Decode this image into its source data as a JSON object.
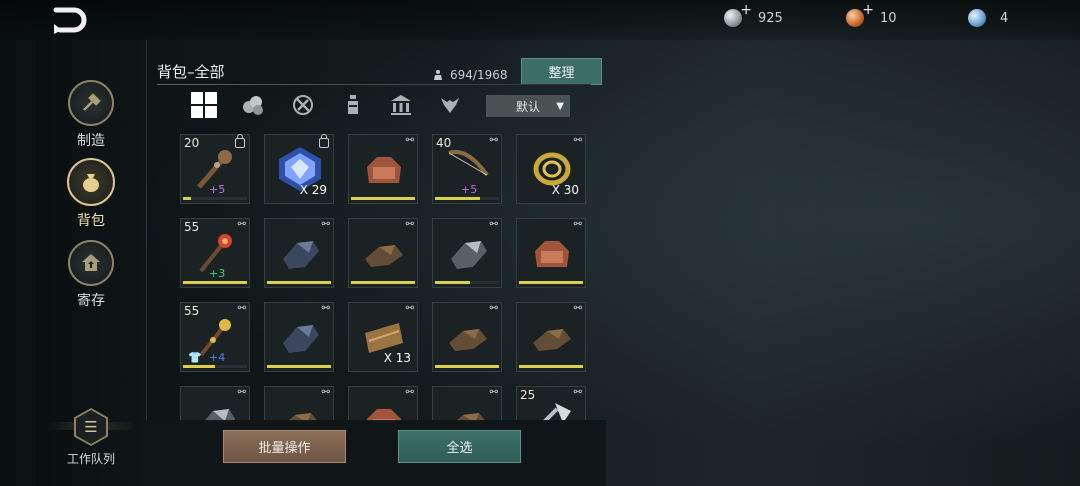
{
  "header": {
    "currencies": [
      {
        "icon": "silver-coin-icon",
        "value": "925"
      },
      {
        "icon": "bronze-coin-icon",
        "value": "10"
      },
      {
        "icon": "blue-orb-icon",
        "value": "4"
      }
    ]
  },
  "sidebar": {
    "items": [
      {
        "label": "制造",
        "icon": "hammer-icon",
        "active": false
      },
      {
        "label": "背包",
        "icon": "bag-icon",
        "active": true
      },
      {
        "label": "寄存",
        "icon": "storage-icon",
        "active": false
      }
    ],
    "work_queue": {
      "label": "工作队列",
      "icon": "queue-icon"
    }
  },
  "panel": {
    "title": "背包–全部",
    "capacity": "694/1968",
    "sort_label": "整理",
    "filter_dropdown": "默认",
    "filter_tabs": [
      "all-icon",
      "resources-icon",
      "tools-icon",
      "potion-icon",
      "building-icon",
      "creature-icon"
    ]
  },
  "inventory": [
    {
      "level": "20",
      "lock": true,
      "plus": "+5",
      "plus_color": "#c36ee8",
      "qty": "",
      "durability": 0.12,
      "item": "spiked-club"
    },
    {
      "level": "",
      "lock": true,
      "plus": "",
      "plus_color": "",
      "qty": "X 29",
      "durability": null,
      "item": "blue-crystal"
    },
    {
      "level": "",
      "lock": false,
      "plus": "",
      "plus_color": "",
      "qty": "",
      "durability": 1.0,
      "item": "leather-armor"
    },
    {
      "level": "40",
      "lock": false,
      "plus": "+5",
      "plus_color": "#c36ee8",
      "qty": "",
      "durability": 0.7,
      "item": "bow"
    },
    {
      "level": "",
      "lock": false,
      "plus": "",
      "plus_color": "",
      "qty": "X 30",
      "durability": null,
      "item": "rope"
    },
    {
      "level": "55",
      "lock": false,
      "plus": "+3",
      "plus_color": "#3fd36a",
      "qty": "",
      "durability": 1.0,
      "item": "fire-staff"
    },
    {
      "level": "",
      "lock": false,
      "plus": "",
      "plus_color": "",
      "qty": "",
      "durability": 1.0,
      "item": "blue-gauntlet"
    },
    {
      "level": "",
      "lock": false,
      "plus": "",
      "plus_color": "",
      "qty": "",
      "durability": 1.0,
      "item": "leather-gauntlet"
    },
    {
      "level": "",
      "lock": false,
      "plus": "",
      "plus_color": "",
      "qty": "",
      "durability": 0.55,
      "item": "steel-gauntlet"
    },
    {
      "level": "",
      "lock": false,
      "plus": "",
      "plus_color": "",
      "qty": "",
      "durability": 1.0,
      "item": "leather-armor"
    },
    {
      "level": "55",
      "lock": false,
      "plus": "+4",
      "plus_color": "#4f7df0",
      "qty": "",
      "durability": 0.5,
      "item": "gold-staff",
      "shirt": true
    },
    {
      "level": "",
      "lock": false,
      "plus": "",
      "plus_color": "",
      "qty": "",
      "durability": 1.0,
      "item": "blue-gauntlet"
    },
    {
      "level": "",
      "lock": false,
      "plus": "",
      "plus_color": "",
      "qty": "X 13",
      "durability": null,
      "item": "leather-bundle"
    },
    {
      "level": "",
      "lock": false,
      "plus": "",
      "plus_color": "",
      "qty": "",
      "durability": 1.0,
      "item": "leather-gauntlet"
    },
    {
      "level": "",
      "lock": false,
      "plus": "",
      "plus_color": "",
      "qty": "",
      "durability": 1.0,
      "item": "leather-gauntlet"
    },
    {
      "level": "",
      "lock": false,
      "plus": "",
      "plus_color": "",
      "qty": "",
      "durability": null,
      "item": "steel-gauntlet"
    },
    {
      "level": "",
      "lock": false,
      "plus": "",
      "plus_color": "",
      "qty": "",
      "durability": null,
      "item": "leather-gauntlet"
    },
    {
      "level": "",
      "lock": false,
      "plus": "",
      "plus_color": "",
      "qty": "",
      "durability": null,
      "item": "leather-armor"
    },
    {
      "level": "",
      "lock": false,
      "plus": "",
      "plus_color": "",
      "qty": "",
      "durability": null,
      "item": "leather-gauntlet"
    },
    {
      "level": "25",
      "lock": false,
      "plus": "",
      "plus_color": "",
      "qty": "",
      "durability": null,
      "item": "battle-axe"
    }
  ],
  "footer": {
    "batch_label": "批量操作",
    "select_all_label": "全选"
  }
}
